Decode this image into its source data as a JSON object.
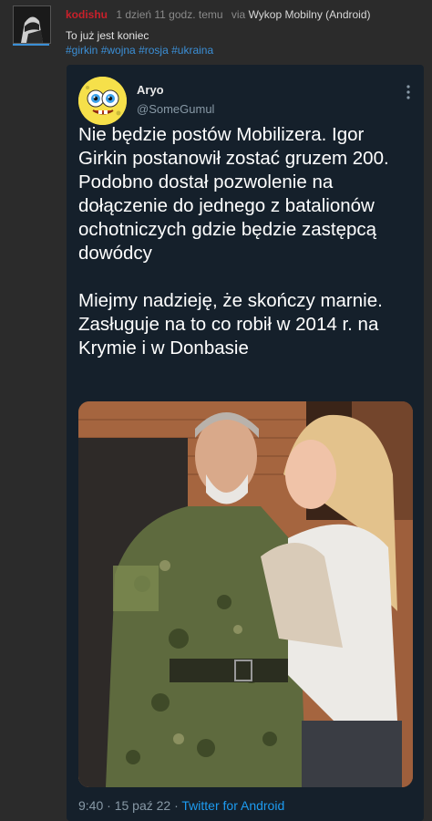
{
  "post": {
    "username": "kodishu",
    "time_ago": "1 dzień 11 godz. temu",
    "via_label": "via",
    "app": "Wykop Mobilny (Android)",
    "text": "To już jest koniec",
    "tags": [
      "#girkin",
      "#wojna",
      "#rosja",
      "#ukraina"
    ]
  },
  "tweet": {
    "name": "Aryo",
    "handle": "@SomeGumul",
    "paragraph1": "Nie będzie postów Mobilizera. Igor Girkin postanowił zostać gruzem 200. Podobno dostał pozwolenie na dołączenie do jednego z batalionów ochotniczych gdzie będzie zastępcą dowódcy",
    "paragraph2": "Miejmy nadzieję, że skończy marnie. Zasługuje na to co robił w 2014 r. na Krymie i w Donbasie",
    "time": "9:40",
    "dot1": "·",
    "date": "15 paź 22",
    "dot2": "·",
    "source": "Twitter for Android"
  },
  "colors": {
    "username": "#c9202a",
    "link": "#3b8fd6",
    "tweet_bg": "#15202b",
    "twitter_blue": "#1d9bf0"
  },
  "icons": [
    "user-avatar-icon",
    "spongebob-avatar-icon",
    "more-options-icon"
  ]
}
